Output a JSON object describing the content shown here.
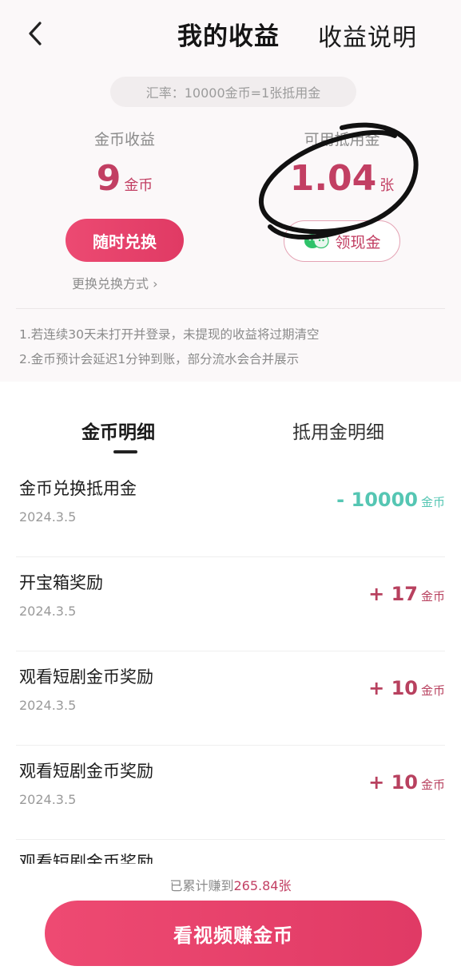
{
  "nav": {
    "title": "我的收益",
    "help_label": "收益说明"
  },
  "rate_text": "汇率：10000金币=1张抵用金",
  "coin": {
    "label": "金币收益",
    "value": "9",
    "unit": "金币",
    "exchange_button": "随时兑换",
    "change_method": "更换兑换方式 ›"
  },
  "voucher": {
    "label": "可用抵用金",
    "value": "1.04",
    "unit": "张",
    "cash_button": "领现金"
  },
  "notes": [
    "1.若连续30天未打开并登录，未提现的收益将过期清空",
    "2.金币预计会延迟1分钟到账，部分流水会合并展示"
  ],
  "tabs": [
    {
      "label": "金币明细",
      "active": true
    },
    {
      "label": "抵用金明细",
      "active": false
    }
  ],
  "records": [
    {
      "title": "金币兑换抵用金",
      "date": "2024.3.5",
      "amount": "- 10000",
      "unit": "金币",
      "sign": "neg"
    },
    {
      "title": "开宝箱奖励",
      "date": "2024.3.5",
      "amount": "+ 17",
      "unit": "金币",
      "sign": "pos"
    },
    {
      "title": "观看短剧金币奖励",
      "date": "2024.3.5",
      "amount": "+ 10",
      "unit": "金币",
      "sign": "pos"
    },
    {
      "title": "观看短剧金币奖励",
      "date": "2024.3.5",
      "amount": "+ 10",
      "unit": "金币",
      "sign": "pos"
    }
  ],
  "partial_record_title": "观看短剧金币奖励",
  "footer": {
    "total_prefix": "已累计赚到",
    "total_value": "265.84张",
    "watch_button": "看视频赚金币"
  },
  "colors": {
    "accent": "#e03a64",
    "value_pink": "#c23f63",
    "negative_teal": "#55c6b3",
    "top_bg": "#fbf8f9"
  },
  "icons": {
    "back": "chevron-left-icon",
    "cash": "wechat-icon",
    "annotation": "hand-drawn-circle"
  }
}
